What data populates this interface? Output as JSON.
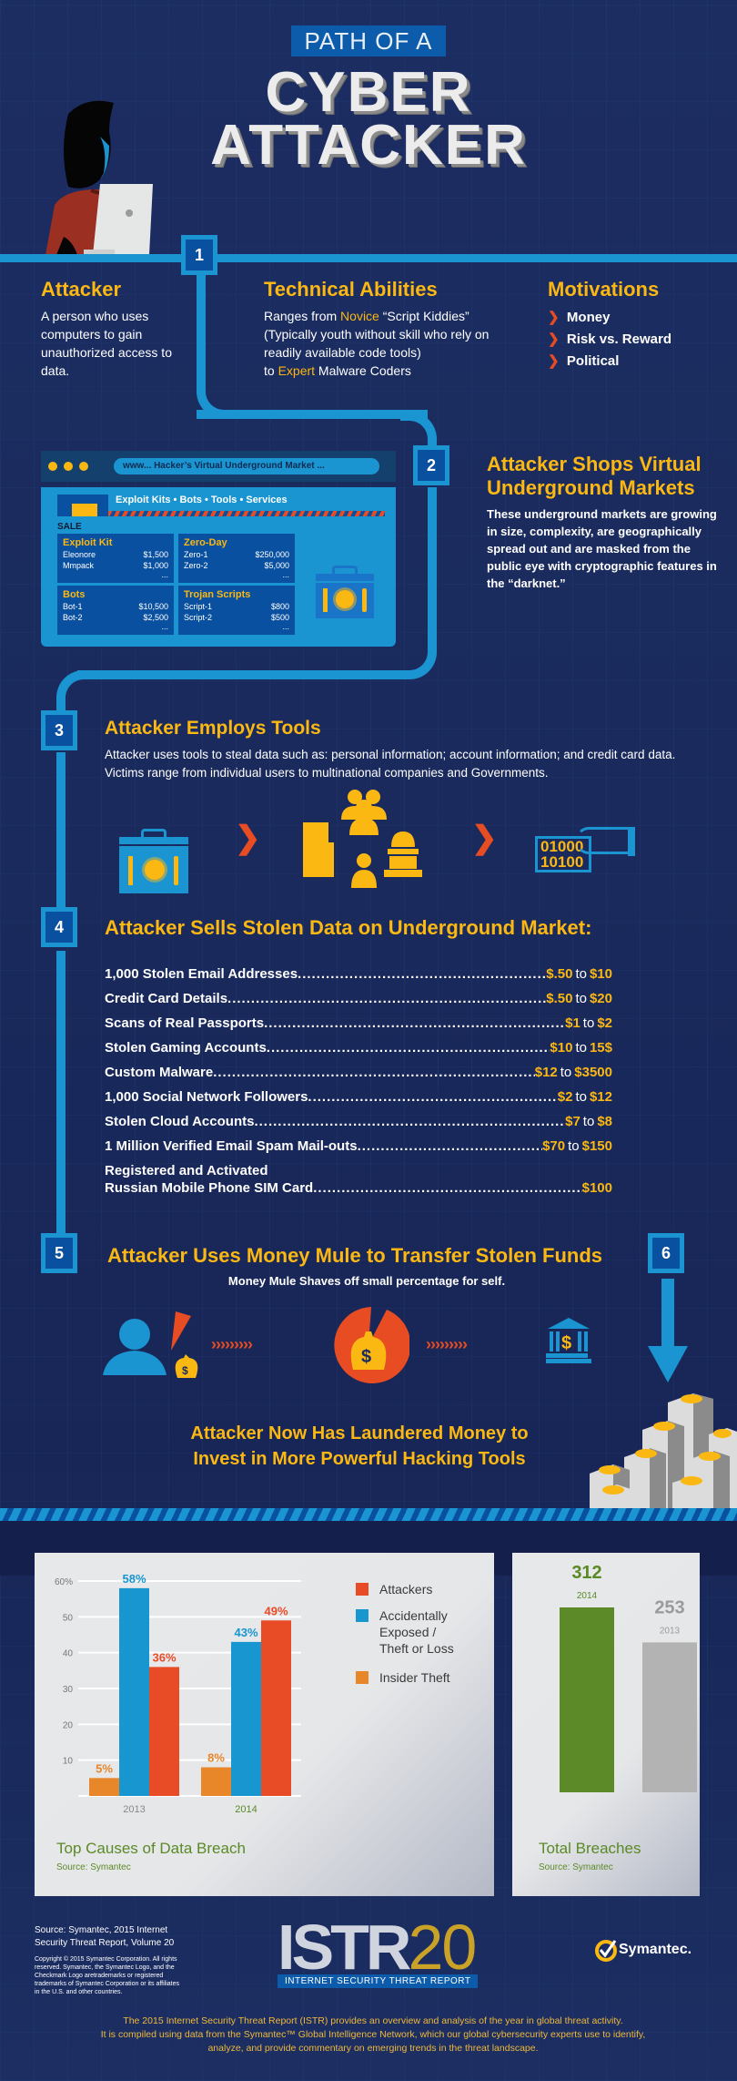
{
  "header": {
    "title_small": "PATH OF A",
    "title_line1": "CYBER",
    "title_line2": "ATTACKER"
  },
  "steps": [
    "1",
    "2",
    "3",
    "4",
    "5",
    "6"
  ],
  "step1": {
    "attacker": {
      "heading": "Attacker",
      "body": "A person who uses computers to gain unauthorized access to data."
    },
    "abilities": {
      "heading": "Technical Abilities",
      "line1_pre": "Ranges from ",
      "line1_hl": "Novice",
      "line1_post": " “Script Kiddies”",
      "line2": "(Typically youth without skill who rely on readily available code tools)",
      "line3_pre": "to ",
      "line3_hl": "Expert",
      "line3_post": " Malware Coders"
    },
    "motivations": {
      "heading": "Motivations",
      "items": [
        "Money",
        "Risk vs. Reward",
        "Political"
      ]
    }
  },
  "market": {
    "url": "www... Hacker’s Virtual Underground Market ...",
    "nav": "Exploit Kits  •  Bots  •  Tools  •  Services",
    "sale_label": "SALE",
    "cards": [
      {
        "title": "Exploit Kit",
        "rows": [
          {
            "name": "Eleonore",
            "price": "$1,500"
          },
          {
            "name": "Mmpack",
            "price": "$1,000"
          }
        ]
      },
      {
        "title": "Zero-Day",
        "rows": [
          {
            "name": "Zero-1",
            "price": "$250,000"
          },
          {
            "name": "Zero-2",
            "price": "$5,000"
          }
        ]
      },
      {
        "title": "Bots",
        "rows": [
          {
            "name": "Bot-1",
            "price": "$10,500"
          },
          {
            "name": "Bot-2",
            "price": "$2,500"
          }
        ]
      },
      {
        "title": "Trojan Scripts",
        "rows": [
          {
            "name": "Script-1",
            "price": "$800"
          },
          {
            "name": "Script-2",
            "price": "$500"
          }
        ]
      }
    ],
    "more": "..."
  },
  "step2": {
    "heading": "Attacker Shops Virtual Underground Markets",
    "body": "These underground markets are growing in size, complexity, are geographically spread out and are masked from the public eye with cryptographic features in the “darknet.”"
  },
  "step3": {
    "heading": "Attacker Employs Tools",
    "body": "Attacker uses tools to steal data such as: personal information; account information; and credit card data. Victims range from individual users to multinational companies and Governments.",
    "binary": [
      "01000",
      "10100"
    ]
  },
  "step4": {
    "heading": "Attacker Sells Stolen Data on Underground Market:",
    "connector": "to",
    "items": [
      {
        "label": "1,000 Stolen Email Addresses",
        "low": "$.50",
        "high": "$10"
      },
      {
        "label": "Credit Card Details",
        "low": "$.50",
        "high": "$20"
      },
      {
        "label": "Scans of Real Passports",
        "low": "$1",
        "high": "$2"
      },
      {
        "label": "Stolen Gaming Accounts",
        "low": "$10",
        "high": "15$"
      },
      {
        "label": "Custom Malware",
        "low": "$12",
        "high": "$3500"
      },
      {
        "label": "1,000 Social Network Followers",
        "low": "$2",
        "high": "$12"
      },
      {
        "label": "Stolen Cloud Accounts",
        "low": "$7",
        "high": "$8"
      },
      {
        "label": "1 Million Verified Email Spam Mail-outs",
        "low": "$70",
        "high": "$150"
      }
    ],
    "last_item": {
      "label_line1": "Registered and Activated",
      "label_line2": "Russian Mobile Phone SIM Card",
      "price": "$100"
    }
  },
  "step5": {
    "heading": "Attacker Uses Money Mule to Transfer Stolen Funds",
    "subtext": "Money Mule Shaves off small percentage for self.",
    "arrows": "›››››››››",
    "dollar": "$"
  },
  "step6": {
    "line1": "Attacker Now Has Laundered Money to",
    "line2": "Invest in More Powerful Hacking Tools"
  },
  "chart_data": [
    {
      "type": "bar",
      "title": "Top Causes of Data Breach",
      "source": "Source: Symantec",
      "categories": [
        "2013",
        "2014"
      ],
      "series": [
        {
          "name": "Insider Theft",
          "values": [
            5,
            8
          ],
          "color": "#e8862a"
        },
        {
          "name": "Accidentally Exposed / Theft or Loss",
          "values": [
            58,
            43
          ],
          "color": "#1796d0"
        },
        {
          "name": "Attackers",
          "values": [
            36,
            49
          ],
          "color": "#e84c27"
        }
      ],
      "legend": [
        {
          "name": "Attackers",
          "color": "#e84c27"
        },
        {
          "name": "Accidentally Exposed / Theft or Loss",
          "color": "#1796d0"
        },
        {
          "name": "Insider Theft",
          "color": "#e8862a"
        }
      ],
      "yticks": [
        "60%",
        "50",
        "40",
        "30",
        "20",
        "10"
      ],
      "ytick_values": [
        60,
        50,
        40,
        30,
        20,
        10
      ],
      "ylim": [
        0,
        60
      ],
      "legend_position": "right",
      "grid": true
    },
    {
      "type": "bar",
      "title": "Total Breaches",
      "source": "Source: Symantec",
      "categories": [
        "2014",
        "2013"
      ],
      "values": [
        312,
        253
      ],
      "colors": [
        "#5d8a28",
        "#b3b3b3"
      ],
      "ylim": [
        0,
        312
      ]
    }
  ],
  "footer": {
    "source": "Source: Symantec, 2015 Internet Security Threat Report, Volume 20",
    "copyright": "Copyright © 2015 Symantec Corporation. All rights reserved. Symantec, the Symantec Logo, and the Checkmark Logo aretrademarks or registered trademarks of Symantec Corporation or its affiliates in the U.S. and other countries.",
    "istr": "ISTR",
    "istr_num": "20",
    "istr_sub": "INTERNET SECURITY THREAT REPORT",
    "brand": "Symantec.",
    "blurb_line1": "The 2015 Internet Security Threat Report (ISTR) provides an overview and analysis of the year in global threat activity.",
    "blurb_line2": "It is compiled using data from the Symantec™ Global Intelligence Network, which our global cybersecurity experts use to identify,",
    "blurb_line3": "analyze, and provide commentary on emerging trends in the threat landscape."
  }
}
